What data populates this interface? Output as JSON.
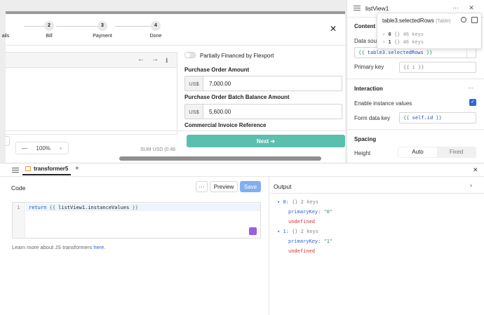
{
  "canvas": {
    "stepper": {
      "steps": [
        {
          "label": "ails",
          "num": ""
        },
        {
          "label": "Bill",
          "num": "2"
        },
        {
          "label": "Payment",
          "num": "3"
        },
        {
          "label": "Done",
          "num": "4"
        }
      ]
    },
    "close_glyph": "✕",
    "nav_icons": {
      "back": "←",
      "forward": "→",
      "download": "⭳"
    },
    "toggle_label": "Partially Financed by Flexport",
    "po_amount_label": "Purchase Order Amount",
    "po_amount": {
      "currency": "US$",
      "value": "7,000.00"
    },
    "po_batch_label": "Purchase Order Batch Balance Amount",
    "po_batch": {
      "currency": "US$",
      "value": "5,600.00"
    },
    "invoice_ref_label": "Commercial Invoice Reference",
    "next_label": "Next ➜",
    "zoom": {
      "minus": "—",
      "value": "100%",
      "plus": "+"
    },
    "behind_text": "SUM USD (0.46"
  },
  "right_panel": {
    "component_name": "listView1",
    "section_content": "Content",
    "data_source_label": "Data sou",
    "data_source_value": {
      "open": "{{",
      "id": "table3.selectedRows",
      "close": "}}"
    },
    "primary_key_label": "Primary key",
    "primary_key_value": "{{ i }}",
    "section_interaction": "Interaction",
    "enable_instance_label": "Enable instance values",
    "form_data_key_label": "Form data key",
    "form_data_key_value": {
      "open": "{{",
      "id": "self.id",
      "close": "}}"
    },
    "section_spacing": "Spacing",
    "height_label": "Height",
    "height_options": [
      "Auto",
      "Fixed"
    ],
    "more_glyph": "···"
  },
  "tooltip": {
    "title": "table3.selectedRows",
    "type": "(Table)",
    "rows": [
      {
        "index": "0",
        "braces": "{}",
        "keys": "46 keys"
      },
      {
        "index": "1",
        "braces": "{}",
        "keys": "46 keys"
      }
    ]
  },
  "bottom": {
    "tab_name": "transformer5",
    "add_glyph": "+",
    "close_glyph": "✕",
    "code_label": "Code",
    "preview_label": "Preview",
    "save_label": "Save",
    "line_number": "1",
    "code": {
      "kw": "return",
      "open": "{{",
      "id": "listView1.instanceValues",
      "close": "}}"
    },
    "help_text": "Learn more about JS transformers ",
    "help_link": "here",
    "help_tail": ".",
    "output_label": "Output",
    "output": [
      {
        "index": "0:",
        "braces": "{}",
        "keys": "2 keys",
        "pk_label": "primaryKey:",
        "pk_value": "\"0\"",
        "undef": "undefined"
      },
      {
        "index": "1:",
        "braces": "{}",
        "keys": "2 keys",
        "pk_label": "primaryKey:",
        "pk_value": "\"1\"",
        "undef": "undefined"
      }
    ]
  },
  "colors": {
    "accent_teal": "#5bbfae",
    "accent_blue": "#6aa0f0",
    "save_bg": "#82aef2",
    "link_blue": "#2e67d6",
    "undefined_red": "#d0342c",
    "output_blue": "#2e67d6"
  }
}
